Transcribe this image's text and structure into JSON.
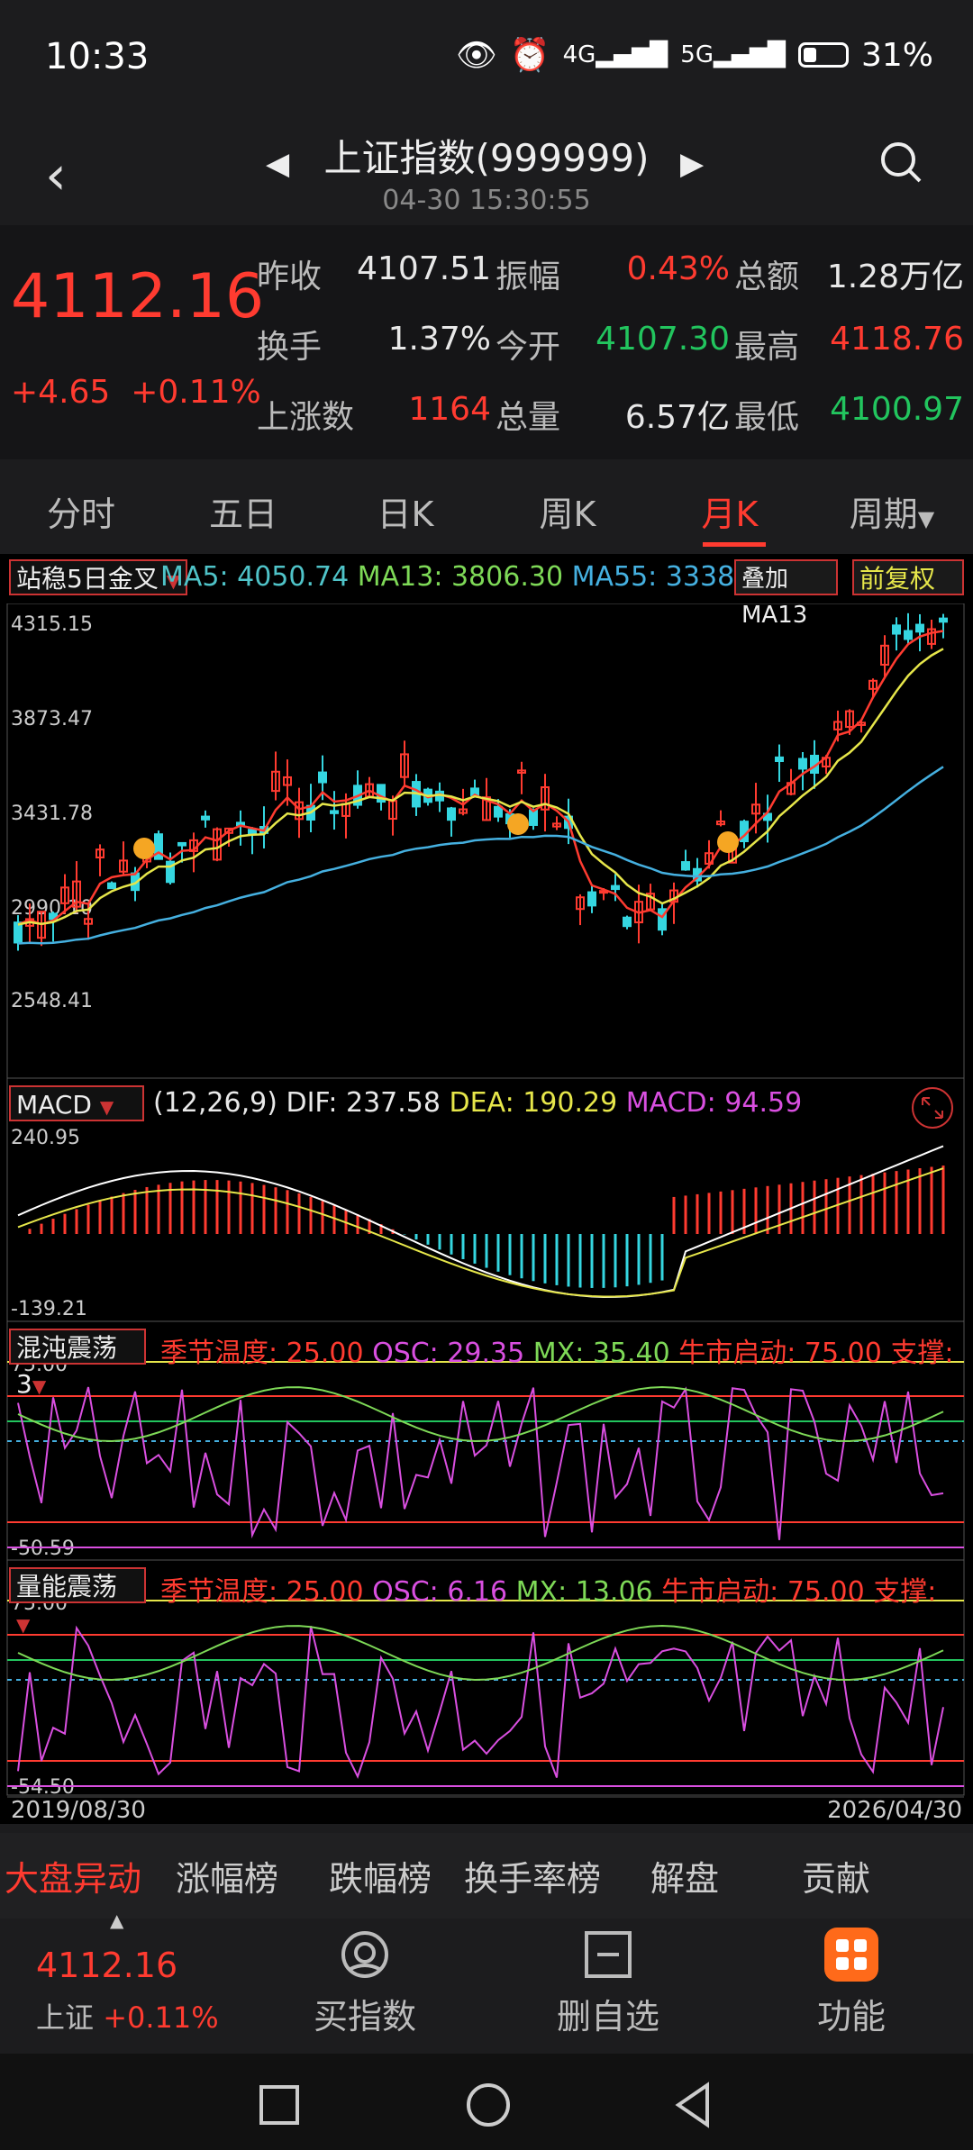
{
  "status": {
    "time": "10:33",
    "battery": "31%",
    "net1": "4G",
    "net2": "5G"
  },
  "header": {
    "title": "上证指数(999999)",
    "subtitle": "04-30 15:30:55"
  },
  "quote": {
    "price": "4112.16",
    "change": "+4.65",
    "change_pct": "+0.11%",
    "rows": [
      [
        {
          "label": "昨收",
          "value": "4107.51",
          "color": "white"
        },
        {
          "label": "振幅",
          "value": "0.43%",
          "color": "red"
        },
        {
          "label": "总额",
          "value": "1.28万亿",
          "color": "white"
        }
      ],
      [
        {
          "label": "换手",
          "value": "1.37%",
          "color": "white"
        },
        {
          "label": "今开",
          "value": "4107.30",
          "color": "green"
        },
        {
          "label": "最高",
          "value": "4118.76",
          "color": "red"
        }
      ],
      [
        {
          "label": "上涨数",
          "value": "1164",
          "color": "red"
        },
        {
          "label": "总量",
          "value": "6.57亿",
          "color": "white"
        },
        {
          "label": "最低",
          "value": "4100.97",
          "color": "green"
        }
      ]
    ]
  },
  "tabs": [
    "分时",
    "五日",
    "日K",
    "周K",
    "月K",
    "周期"
  ],
  "active_tab": "月K",
  "main_chart": {
    "indicator": "站稳5日金叉",
    "ma5": "MA5: 4050.74",
    "ma13": "MA13: 3806.30",
    "ma55": "MA55: 3338.",
    "btn_overlay": "叠加MA13",
    "btn_adjust": "前复权",
    "y_labels": [
      "4315.15",
      "3873.47",
      "3431.78",
      "2990.10",
      "2548.41"
    ]
  },
  "macd": {
    "indicator": "MACD",
    "params": "(12,26,9)",
    "dif": "DIF: 237.58",
    "dea": "DEA: 190.29",
    "macd": "MACD: 94.59",
    "y_top": "240.95",
    "y_bottom": "-139.21"
  },
  "osc1": {
    "indicator": "混沌震荡3",
    "season": "季节温度: 25.00",
    "osc": "OSC: 29.35",
    "mx": "MX: 35.40",
    "bull": "牛市启动: 75.00",
    "support": "支撑:",
    "y_top": "75.00",
    "y_bottom": "-50.59"
  },
  "osc2": {
    "indicator": "量能震荡",
    "season": "季节温度: 25.00",
    "osc": "OSC: 6.16",
    "mx": "MX: 13.06",
    "bull": "牛市启动: 75.00",
    "support": "支撑:",
    "y_top": "75.00",
    "y_bottom": "-54.50"
  },
  "dates": {
    "start": "2019/08/30",
    "end": "2026/04/30"
  },
  "rank_tabs": [
    "大盘异动",
    "涨幅榜",
    "跌幅榜",
    "换手率榜",
    "解盘",
    "贡献"
  ],
  "bottom_nav": {
    "price": "4112.16",
    "index_name": "上证",
    "index_change": "+0.11%",
    "items": [
      "买指数",
      "删自选",
      "功能"
    ]
  }
}
